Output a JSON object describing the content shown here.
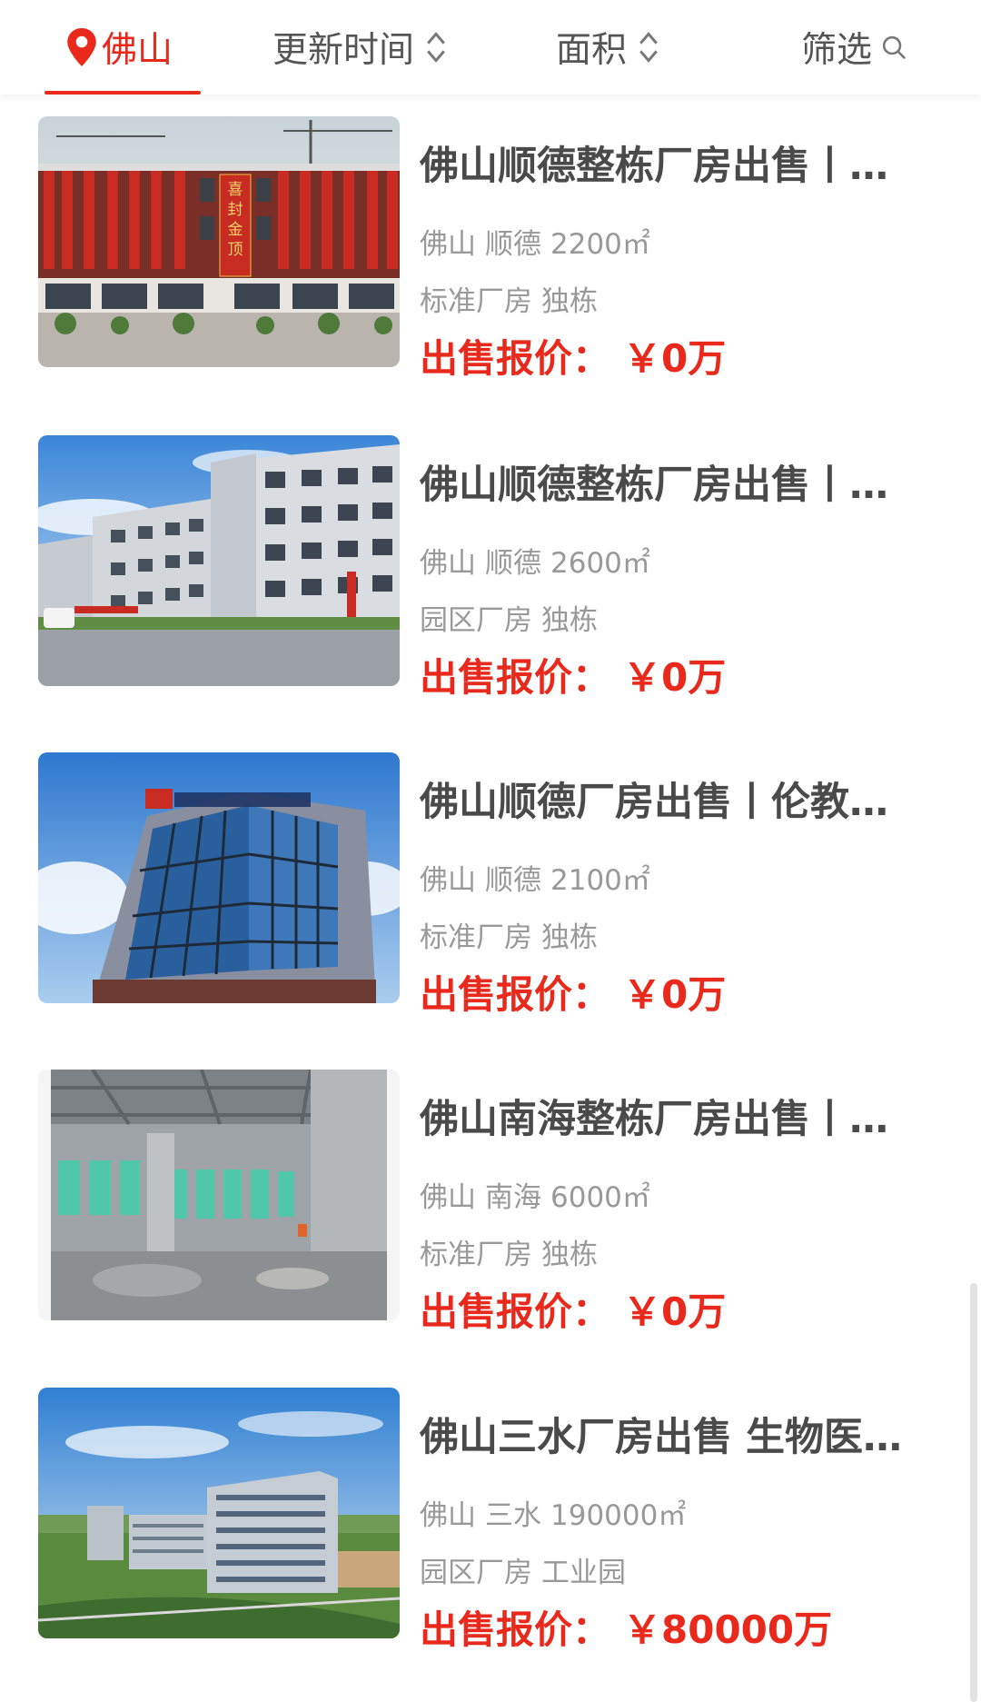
{
  "filter_bar": {
    "city_label": "佛山",
    "sort_time_label": "更新时间",
    "sort_area_label": "面积",
    "filter_label": "筛选"
  },
  "colors": {
    "accent": "#e8291c",
    "title_text": "#4a4a4a",
    "meta_text": "#999999"
  },
  "listings": [
    {
      "title": "佛山顺德整栋厂房出售丨…",
      "city": "佛山",
      "district": "顺德",
      "area": "2200㎡",
      "type": "标准厂房",
      "building": "独栋",
      "price_label": "出售报价：",
      "price": "￥0万",
      "banner_text": "喜封金顶"
    },
    {
      "title": "佛山顺德整栋厂房出售丨…",
      "city": "佛山",
      "district": "顺德",
      "area": "2600㎡",
      "type": "园区厂房",
      "building": "独栋",
      "price_label": "出售报价：",
      "price": "￥0万"
    },
    {
      "title": "佛山顺德厂房出售丨伦教…",
      "city": "佛山",
      "district": "顺德",
      "area": "2100㎡",
      "type": "标准厂房",
      "building": "独栋",
      "price_label": "出售报价：",
      "price": "￥0万"
    },
    {
      "title": "佛山南海整栋厂房出售丨…",
      "city": "佛山",
      "district": "南海",
      "area": "6000㎡",
      "type": "标准厂房",
      "building": "独栋",
      "price_label": "出售报价：",
      "price": "￥0万"
    },
    {
      "title": "佛山三水厂房出售 生物医…",
      "city": "佛山",
      "district": "三水",
      "area": "190000㎡",
      "type": "园区厂房",
      "building": "工业园",
      "price_label": "出售报价：",
      "price": "￥80000万"
    }
  ]
}
